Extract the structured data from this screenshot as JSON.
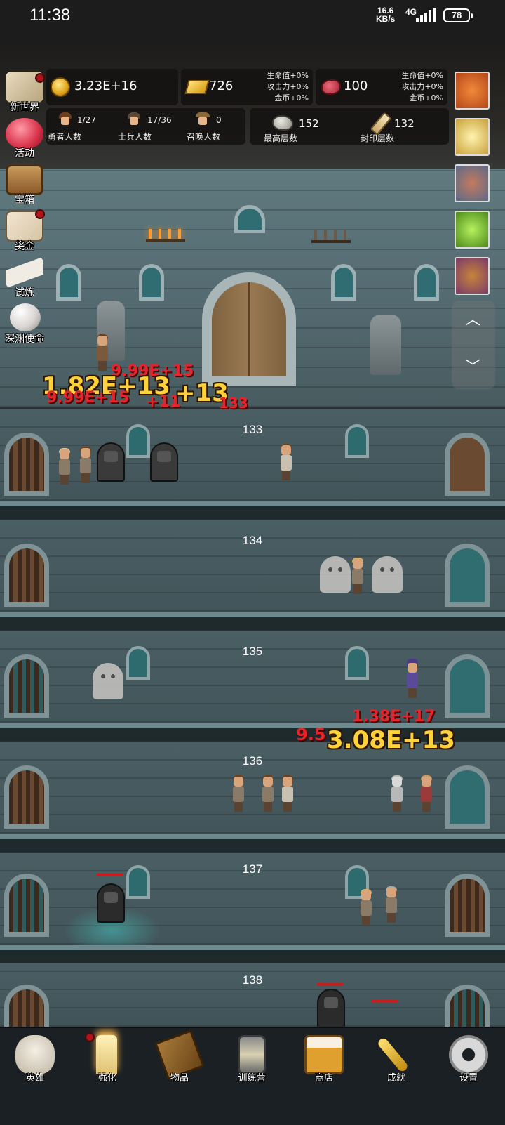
{
  "status_bar": {
    "time": "11:38",
    "net_speed_value": "16.6",
    "net_speed_unit": "KB/s",
    "network": "4G",
    "battery": "78"
  },
  "resources": {
    "coins": "3.23E+16",
    "gold": "726",
    "gems": "100",
    "bonus_gold_panel": {
      "hp": "生命值+0%",
      "atk": "攻击力+0%",
      "coin": "金币+0%"
    },
    "bonus_gem_panel": {
      "hp": "生命值+0%",
      "atk": "攻击力+0%",
      "coin": "金币+0%"
    }
  },
  "counts": {
    "heroes": {
      "value": "1/27",
      "label": "勇者人数"
    },
    "soldiers": {
      "value": "17/36",
      "label": "士兵人数"
    },
    "summons": {
      "value": "0",
      "label": "召唤人数"
    },
    "max_floor": {
      "value": "152",
      "label": "最高层数"
    },
    "sealed_floor": {
      "value": "132",
      "label": "封印层数"
    }
  },
  "side_menu": [
    {
      "label": "新世界",
      "icon": "map-icon",
      "badge": true
    },
    {
      "label": "活动",
      "icon": "heart-icon",
      "badge": false
    },
    {
      "label": "宝箱",
      "icon": "chest-icon",
      "badge": false
    },
    {
      "label": "奖金",
      "icon": "envelope-icon",
      "badge": true
    },
    {
      "label": "试炼",
      "icon": "feather-icon",
      "badge": false
    },
    {
      "label": "深渊使命",
      "icon": "pearl-icon",
      "badge": false
    }
  ],
  "buffs": [
    {
      "icon": "pumpkin-icon",
      "color": "#d9661f"
    },
    {
      "icon": "candle-icon",
      "color": "#f0d060"
    },
    {
      "icon": "backpack-icon",
      "color": "#8a4a3a"
    },
    {
      "icon": "slime-icon",
      "color": "#7ac238"
    },
    {
      "icon": "bag-icon",
      "color": "#a0582c"
    }
  ],
  "floors": [
    {
      "number": "133"
    },
    {
      "number": "134"
    },
    {
      "number": "135"
    },
    {
      "number": "136"
    },
    {
      "number": "137"
    },
    {
      "number": "138"
    }
  ],
  "damage_numbers": {
    "d1": "9.99E+15",
    "d2": "1.82E+13",
    "d3": "9.99E+15",
    "d4": "+11",
    "d5": "+13",
    "d6": "133",
    "d7": "1.38E+17",
    "d8": "9.5",
    "d9": "3.08E+13"
  },
  "bottom_nav": [
    {
      "label": "英雄",
      "icon": "skull-icon",
      "badge": false
    },
    {
      "label": "强化",
      "icon": "candle-icon",
      "badge": true
    },
    {
      "label": "物品",
      "icon": "book-icon",
      "badge": false
    },
    {
      "label": "训练营",
      "icon": "lantern-icon",
      "badge": false
    },
    {
      "label": "商店",
      "icon": "beer-mug-icon",
      "badge": false
    },
    {
      "label": "成就",
      "icon": "key-icon",
      "badge": false
    },
    {
      "label": "设置",
      "icon": "gear-icon",
      "badge": false
    }
  ],
  "colors": {
    "accent_gold": "#ffd23a",
    "damage_red": "#e8232b",
    "badge_red": "#b0141a"
  }
}
